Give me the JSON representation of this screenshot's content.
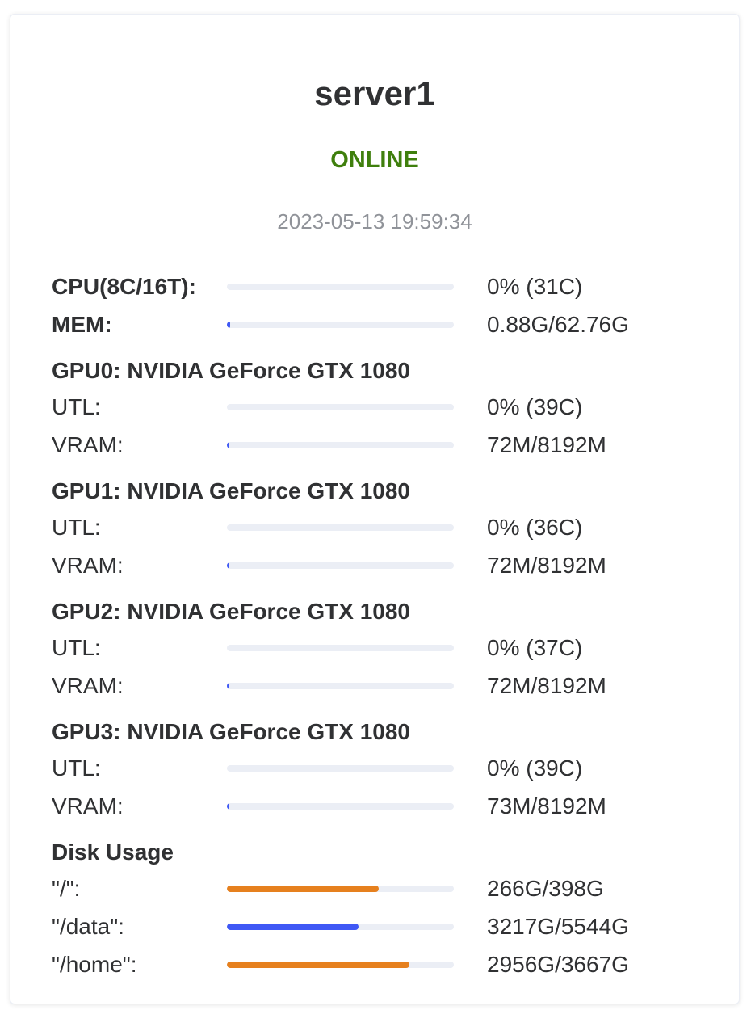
{
  "server": {
    "name": "server1",
    "status": "ONLINE",
    "status_color": "#3f7f0d",
    "timestamp": "2023-05-13 19:59:34"
  },
  "colors": {
    "bar_track": "#ebeef5",
    "bar_blue": "#3f58f5",
    "bar_orange": "#e6801e"
  },
  "system": {
    "cpu": {
      "label": "CPU(8C/16T):",
      "value": "0% (31C)",
      "fraction": 0.0,
      "color": "#3f58f5"
    },
    "mem": {
      "label": "MEM:",
      "value": "0.88G/62.76G",
      "fraction": 0.014,
      "color": "#3f58f5"
    }
  },
  "gpus": [
    {
      "title": "GPU0: NVIDIA GeForce GTX 1080",
      "utl": {
        "label": "UTL:",
        "value": "0% (39C)",
        "fraction": 0.0,
        "color": "#3f58f5"
      },
      "vram": {
        "label": "VRAM:",
        "value": "72M/8192M",
        "fraction": 0.0088,
        "color": "#3f58f5"
      }
    },
    {
      "title": "GPU1: NVIDIA GeForce GTX 1080",
      "utl": {
        "label": "UTL:",
        "value": "0% (36C)",
        "fraction": 0.0,
        "color": "#3f58f5"
      },
      "vram": {
        "label": "VRAM:",
        "value": "72M/8192M",
        "fraction": 0.0088,
        "color": "#3f58f5"
      }
    },
    {
      "title": "GPU2: NVIDIA GeForce GTX 1080",
      "utl": {
        "label": "UTL:",
        "value": "0% (37C)",
        "fraction": 0.0,
        "color": "#3f58f5"
      },
      "vram": {
        "label": "VRAM:",
        "value": "72M/8192M",
        "fraction": 0.0088,
        "color": "#3f58f5"
      }
    },
    {
      "title": "GPU3: NVIDIA GeForce GTX 1080",
      "utl": {
        "label": "UTL:",
        "value": "0% (39C)",
        "fraction": 0.0,
        "color": "#3f58f5"
      },
      "vram": {
        "label": "VRAM:",
        "value": "73M/8192M",
        "fraction": 0.0089,
        "color": "#3f58f5"
      }
    }
  ],
  "disk": {
    "title": "Disk Usage",
    "items": [
      {
        "label": "\"/\":",
        "value": "266G/398G",
        "fraction": 0.668,
        "color": "#e6801e"
      },
      {
        "label": "\"/data\":",
        "value": "3217G/5544G",
        "fraction": 0.58,
        "color": "#3f58f5"
      },
      {
        "label": "\"/home\":",
        "value": "2956G/3667G",
        "fraction": 0.806,
        "color": "#e6801e"
      }
    ]
  }
}
